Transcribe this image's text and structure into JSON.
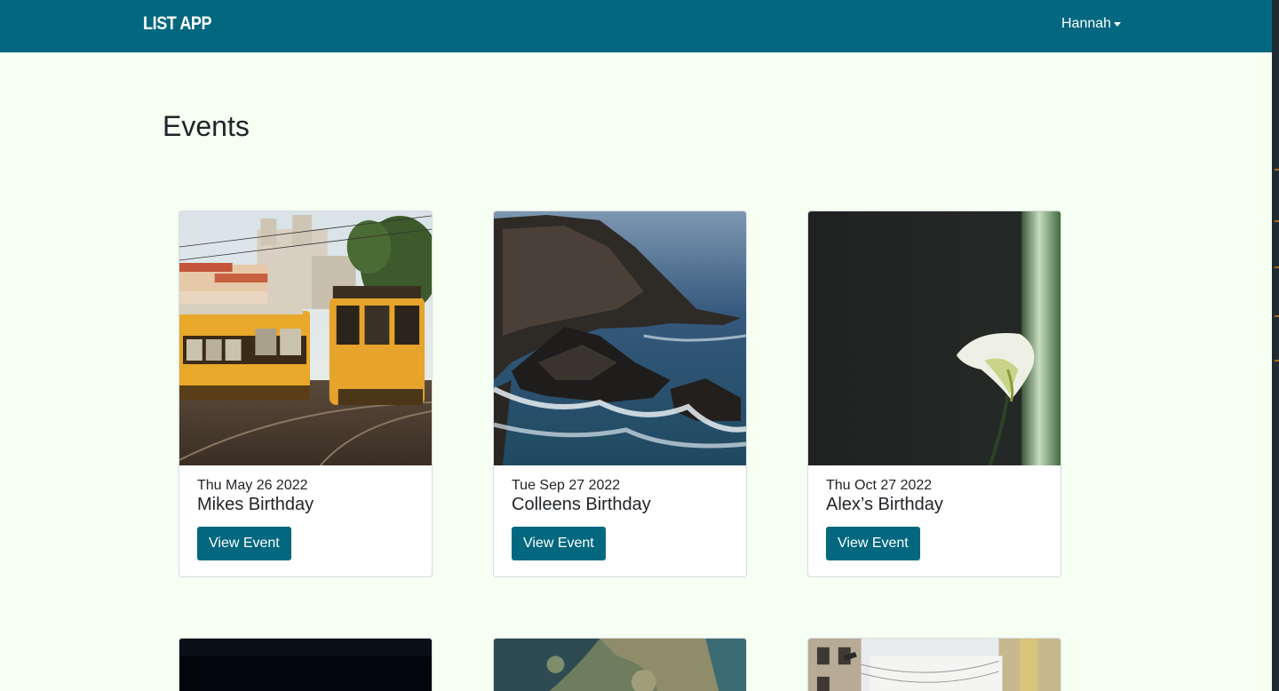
{
  "navbar": {
    "brand": "LIST APP",
    "user_name": "Hannah"
  },
  "page": {
    "title": "Events"
  },
  "events": [
    {
      "date": "Thu May 26 2022",
      "title": "Mikes Birthday",
      "button_label": "View Event",
      "image": "lisbon-trams-photo"
    },
    {
      "date": "Tue Sep 27 2022",
      "title": "Colleens Birthday",
      "button_label": "View Event",
      "image": "coastal-cliffs-photo"
    },
    {
      "date": "Thu Oct 27 2022",
      "title": "Alex’s Birthday",
      "button_label": "View Event",
      "image": "calla-lily-photo"
    }
  ],
  "more_events": [
    {
      "image": "night-sky-photo"
    },
    {
      "image": "aerial-coast-photo"
    },
    {
      "image": "city-street-photo"
    }
  ],
  "colors": {
    "primary": "#02677f",
    "background": "#f5fff2"
  }
}
